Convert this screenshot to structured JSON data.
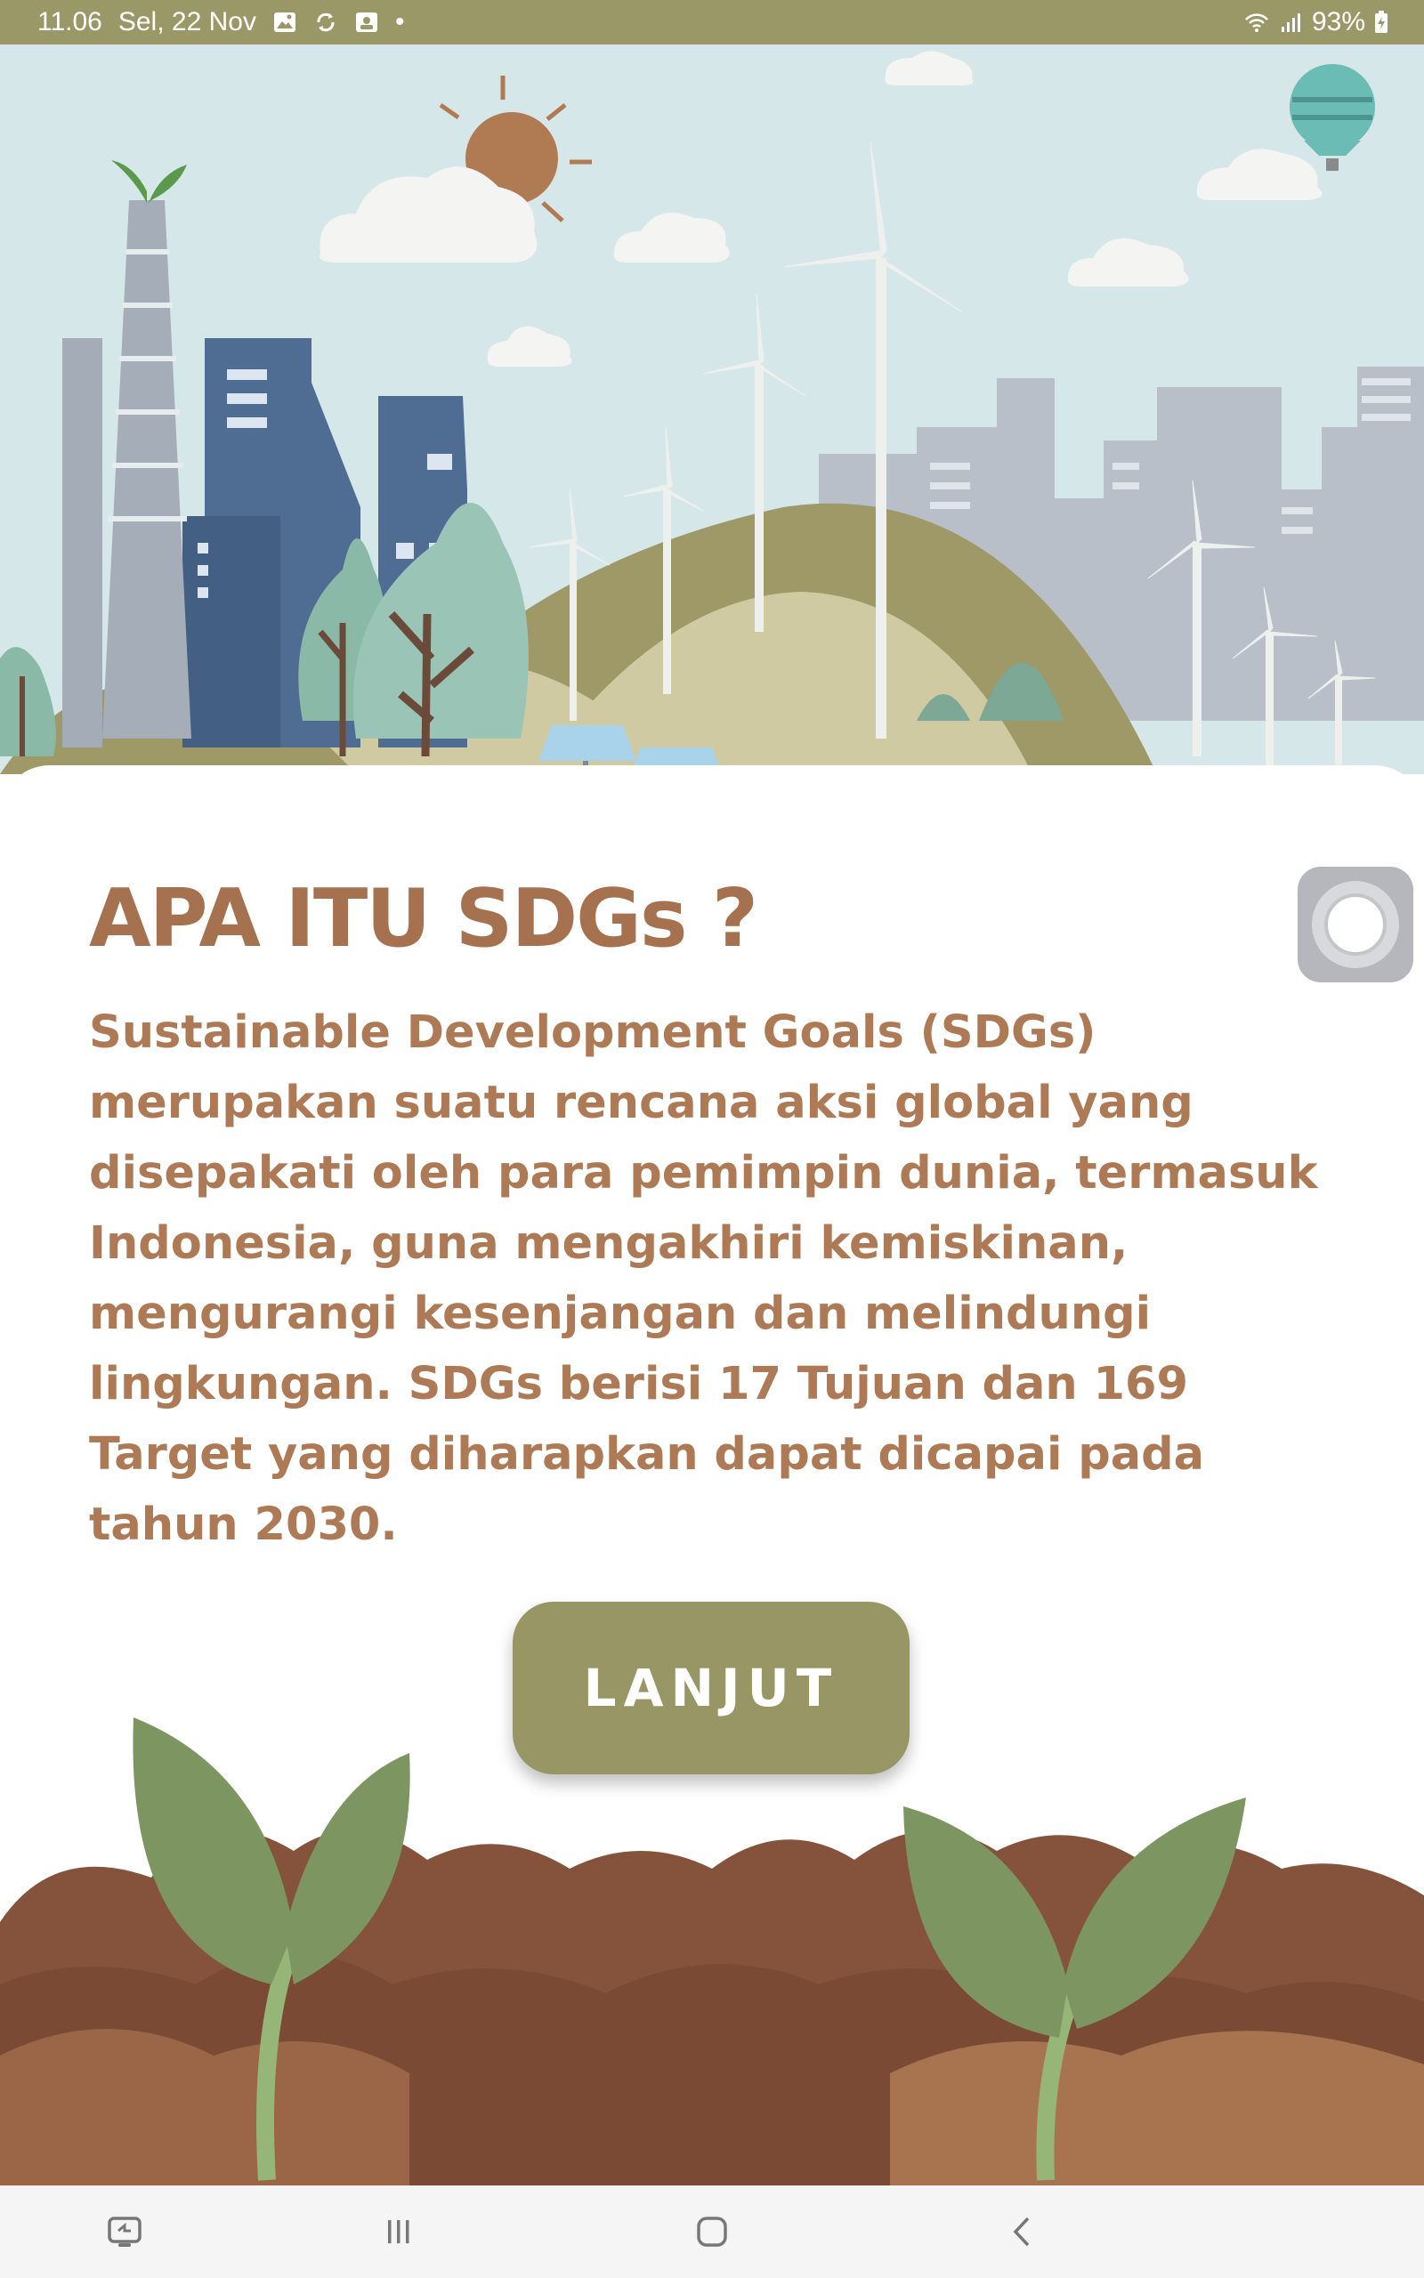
{
  "status_bar": {
    "time": "11.06",
    "date": "Sel, 22 Nov",
    "dot": "•",
    "battery": "93%"
  },
  "card": {
    "title": "APA ITU SDGs ?",
    "description": "Sustainable Development Goals (SDGs) merupakan suatu rencana aksi global yang disepakati oleh para pemimpin dunia, termasuk Indonesia, guna mengakhiri kemiskinan, mengurangi kesenjangan dan melindungi lingkungan. SDGs berisi 17 Tujuan dan 169 Target yang diharapkan dapat dicapai pada tahun 2030."
  },
  "button": {
    "label": "LANJUT"
  },
  "icons": {
    "status": [
      "gallery-icon",
      "sync-icon",
      "screenshot-icon",
      "wifi-icon",
      "signal-icon",
      "battery-charging-icon"
    ],
    "nav": [
      "recent-apps-icon",
      "home-icon",
      "back-icon",
      "screen-switch-icon"
    ],
    "floating": "assistive-touch-icon"
  },
  "colors": {
    "status_bar": "#9b9868",
    "title": "#a6714e",
    "body_text": "#ad7a55",
    "button": "#999665",
    "sky": "#d6e7ea",
    "soil": "#85523c"
  }
}
